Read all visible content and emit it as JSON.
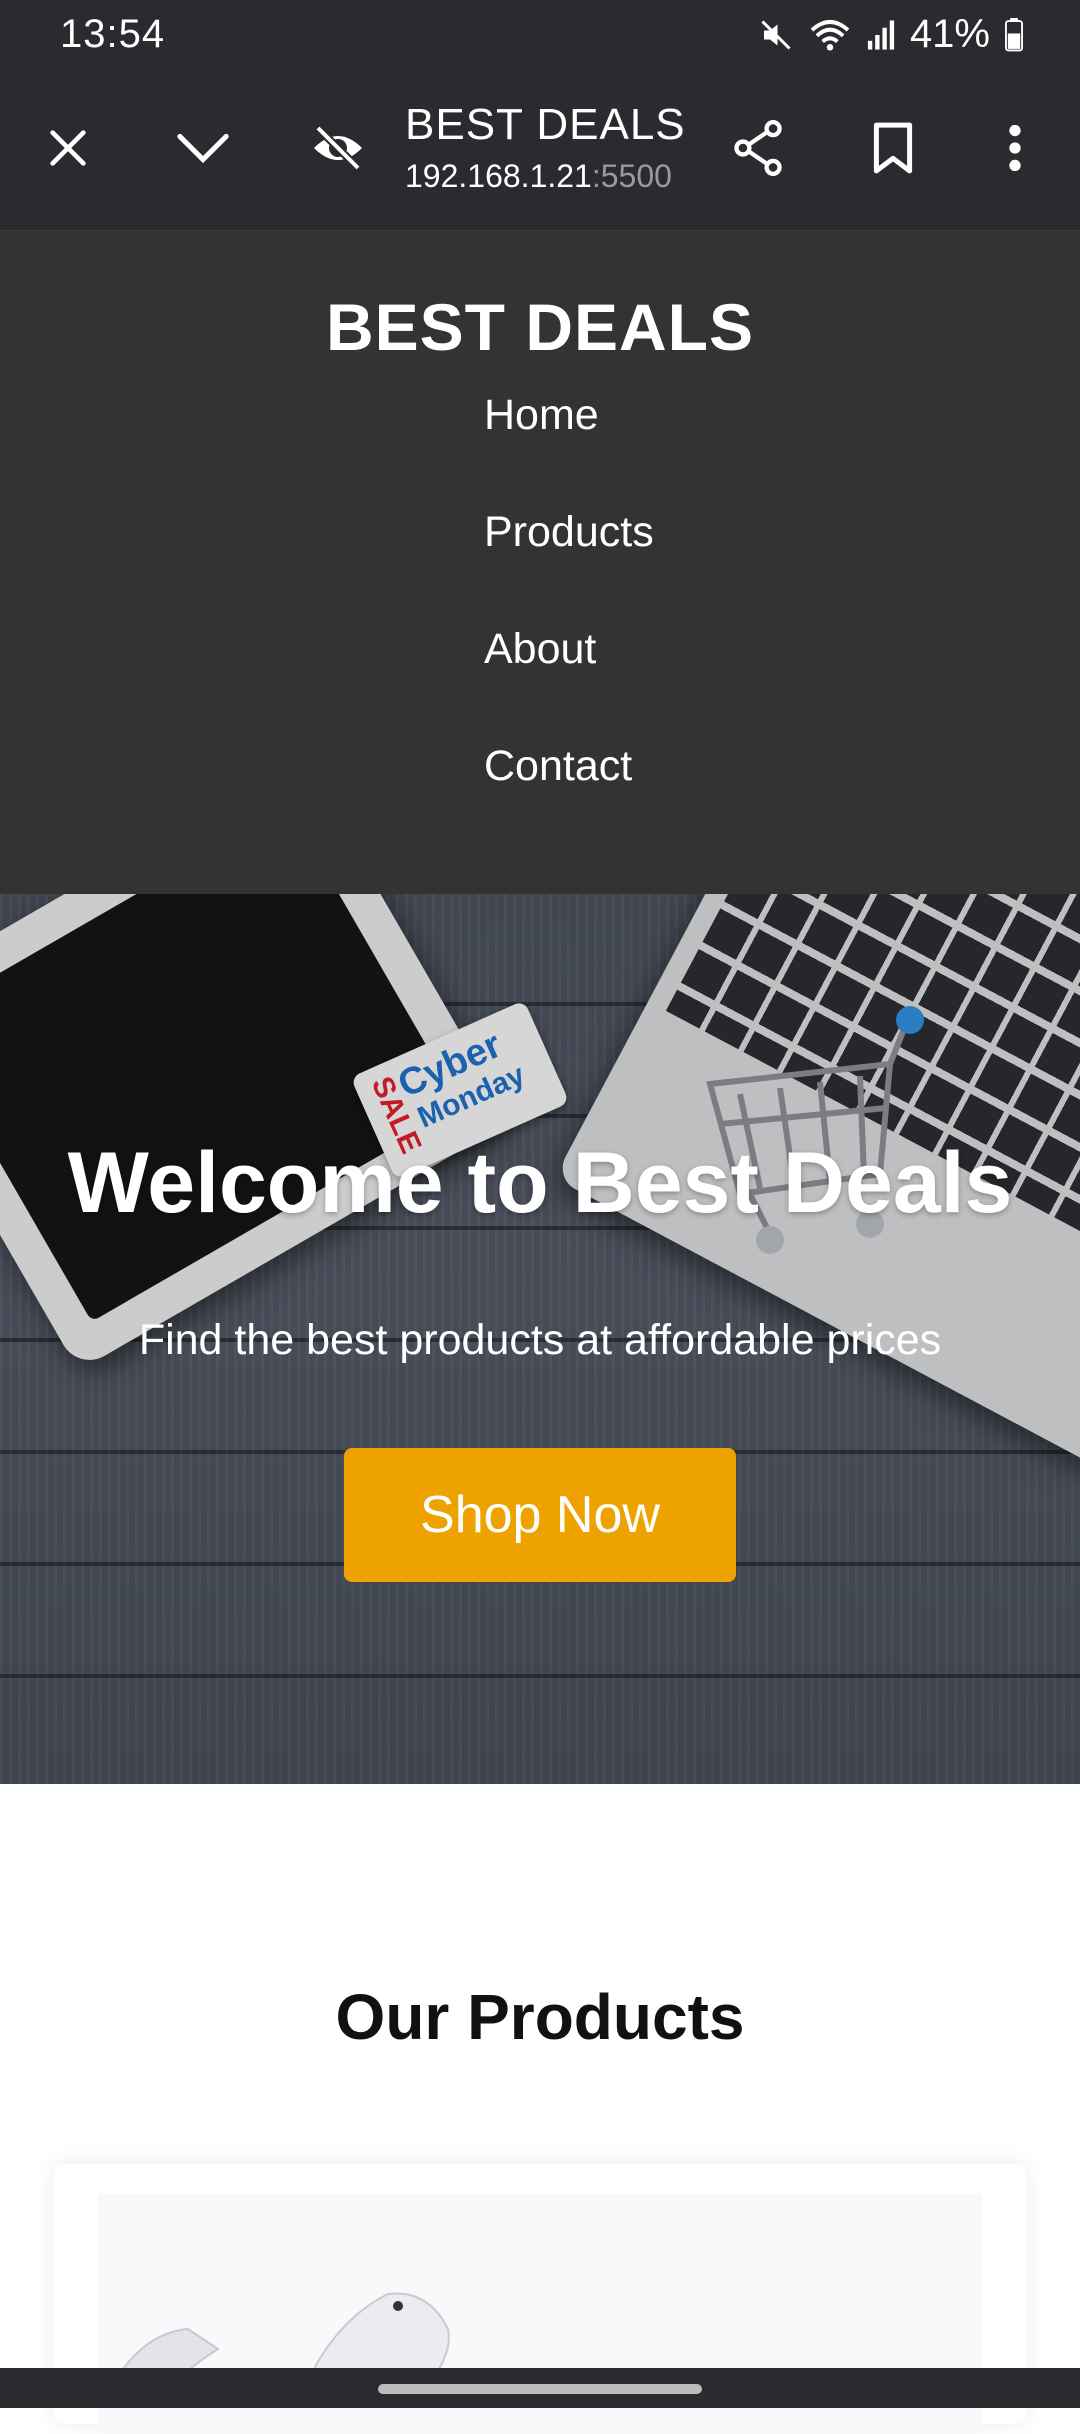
{
  "status_bar": {
    "time": "13:54",
    "battery": "41%",
    "icons": [
      "mute-icon",
      "wifi-icon",
      "signal-icon",
      "battery-icon"
    ]
  },
  "browser": {
    "page_title": "BEST DEALS",
    "url_host": "192.168.1.21",
    "url_port": ":5500",
    "icons": [
      "close-icon",
      "chevron-down-icon",
      "incognito-eye-icon",
      "share-icon",
      "bookmark-icon",
      "more-icon"
    ]
  },
  "site": {
    "logo": "BEST DEALS",
    "nav": [
      {
        "label": "Home"
      },
      {
        "label": "Products"
      },
      {
        "label": "About"
      },
      {
        "label": "Contact"
      }
    ]
  },
  "hero": {
    "title": "Welcome to Best Deals",
    "subtitle": "Find the best products at affordable prices",
    "cta": "Shop Now",
    "tag_line1": "Cyber",
    "tag_line2": "Monday",
    "tag_sale": "SALE",
    "accent_color": "#eea200"
  },
  "products": {
    "title": "Our Products"
  }
}
